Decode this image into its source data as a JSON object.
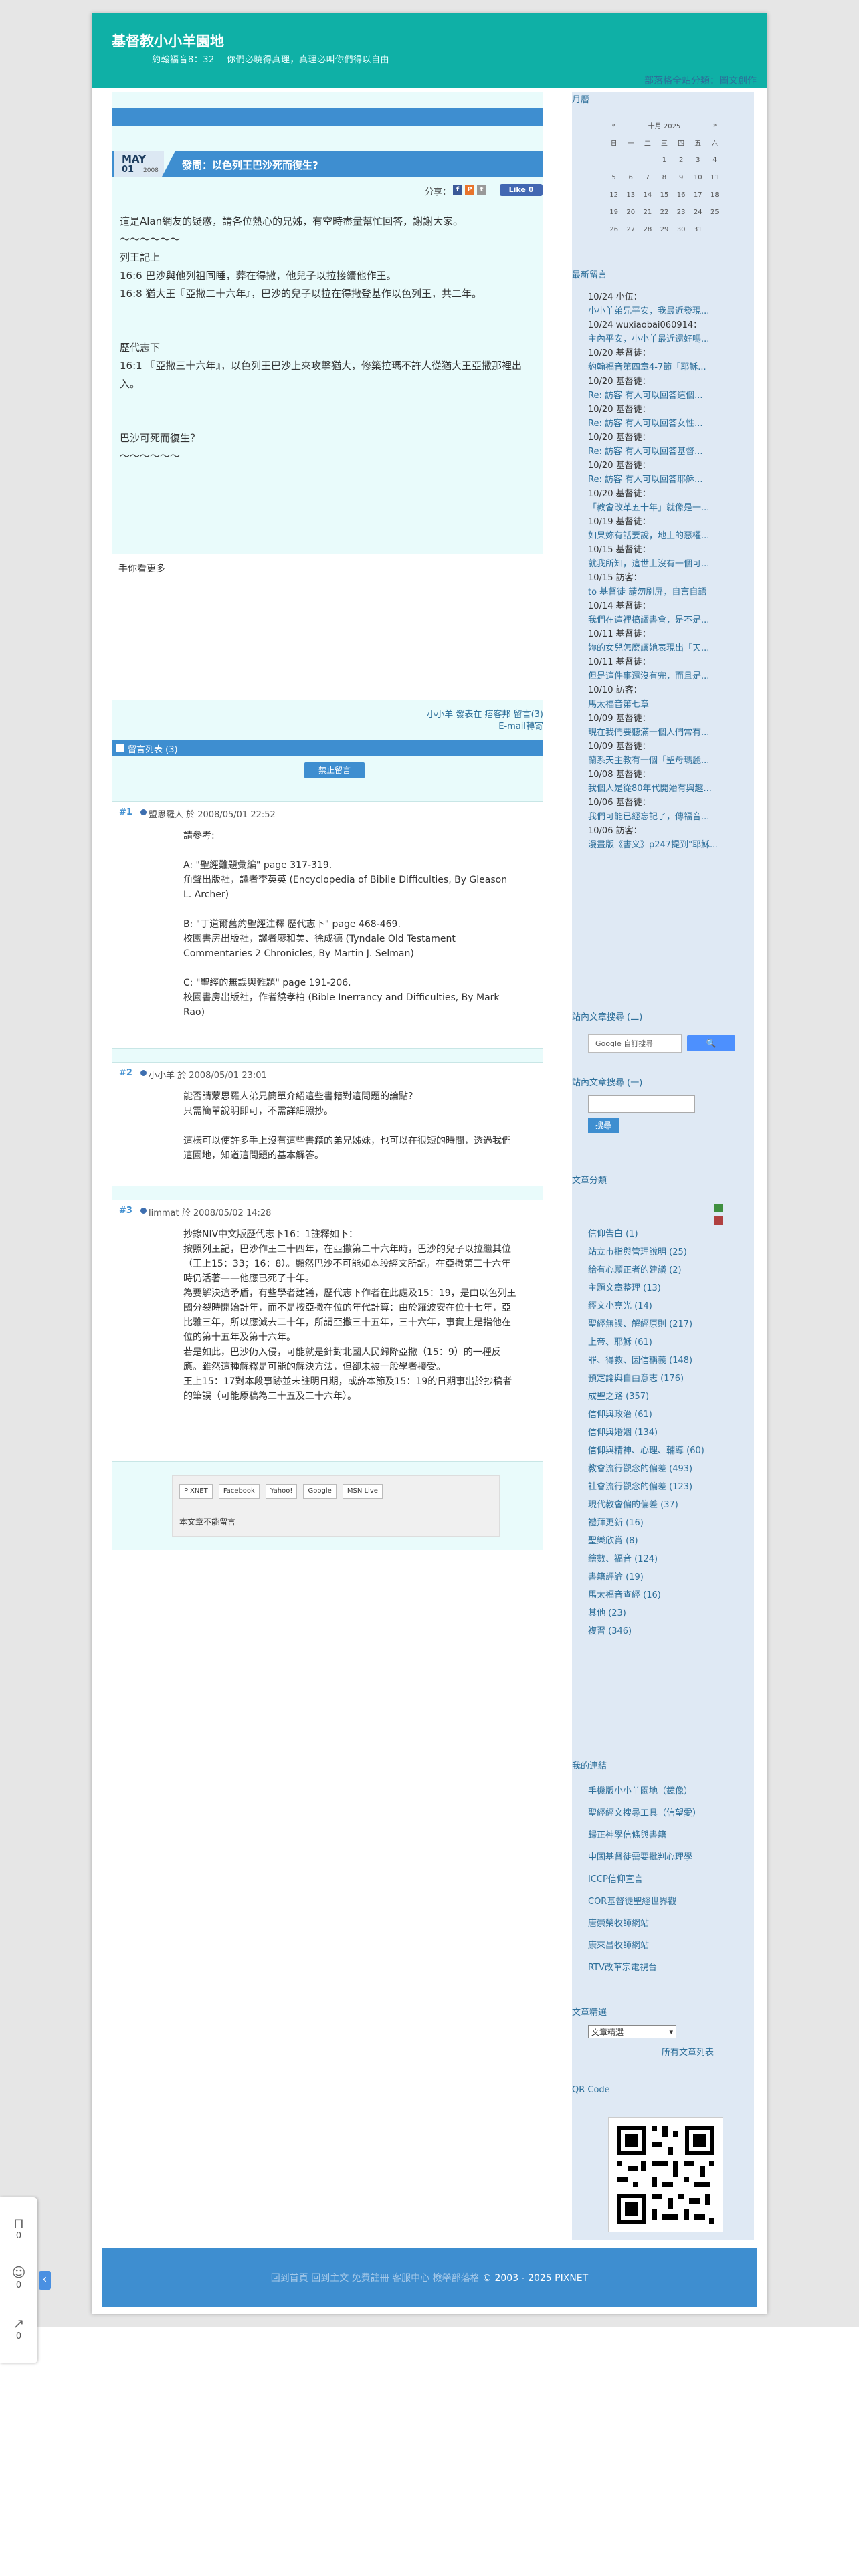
{
  "header": {
    "title": "基督教小小羊園地",
    "description": "約翰福音8：32　 你們必曉得真理，真理必叫你們得以自由",
    "category_link": "部落格全站分類：圖文創作"
  },
  "post": {
    "date": {
      "month": "MAY",
      "day": "01",
      "year": "2008"
    },
    "title": "發問：以色列王巴沙死而復生?",
    "share_label": "分享：",
    "like_label": "Like 0",
    "body": [
      "這是Alan網友的疑惑，請各位熱心的兄姊，有空時盡量幫忙回答，謝謝大家。",
      "〜〜〜〜〜〜",
      "列王記上",
      "16:6 巴沙與他列祖同睡，葬在得撒，他兒子以拉接續他作王。",
      "16:8 猶大王『亞撒二十六年』，巴沙的兒子以拉在得撒登基作以色列王，共二年。",
      "",
      "",
      "歷代志下",
      "16:1 『亞撒三十六年』，以色列王巴沙上來攻擊猶大，修築拉瑪不許人從猶大王亞撒那裡出入。",
      "",
      "",
      "巴沙可死而復生？",
      "〜〜〜〜〜〜"
    ],
    "recommend_label": "手你看更多",
    "meta_line1": "小小羊 發表在 痞客邦 留言(3)",
    "meta_line2": "E-mail轉寄"
  },
  "comments_header": "留言列表 (3)",
  "disable_comment_button": "禁止留言",
  "comments": [
    {
      "num": "#1",
      "author_line": "盟思羅人 於 2008/05/01 22:52",
      "body": "請參考:\n\nA: \"聖經難題彙編\" page 317-319.\n角聲出版社，譯者李英英 (Encyclopedia of Bibile Difficulties, By Gleason L. Archer)\n\nB: \"丁道爾舊約聖經注釋 歷代志下\" page 468-469.\n校園書房出版社，譯者廖和美、徐成德 (Tyndale Old Testament Commentaries 2 Chronicles, By Martin J. Selman)\n\nC: \"聖經的無誤與難題\" page 191-206.\n校園書房出版社，作者饒孝柏 (Bible Inerrancy and Difficulties, By Mark Rao)"
    },
    {
      "num": "#2",
      "author_line": "小小羊 於 2008/05/01 23:01",
      "body": "能否請蒙思羅人弟兄簡單介紹這些書籍對這問題的論點？\n只需簡單說明即可，不需詳細照抄。\n\n這樣可以使許多手上沒有這些書籍的弟兄姊妹，也可以在很短的時間，透過我們這園地，知道這問題的基本解答。"
    },
    {
      "num": "#3",
      "author_line": "limmat 於 2008/05/02 14:28",
      "body": "抄錄NIV中文版歷代志下16：1註釋如下：\n按照列王記，巴沙作王二十四年，在亞撒第二十六年時，巴沙的兒子以拉繼其位（王上15：33；16：8）。顯然巴沙不可能如本段經文所記，在亞撒第三十六年時仍活著——他應已死了十年。\n為要解決這矛盾，有些學者建議，歷代志下作者在此處及15：19，是由以色列王國分裂時開始計年，而不是按亞撒在位的年代計算：由於羅波安在位十七年，亞比雅三年，所以應減去二十年，所謂亞撒三十五年，三十六年，事實上是指他在位的第十五年及第十六年。\n若是如此，巴沙仍入侵，可能就是針對北國人民歸降亞撒（15：9）的一種反應。雖然這種解釋是可能的解決方法，但卻未被一般學者接受。\n王上15：17對本段事跡並未註明日期，或許本節及15：19的日期事出於抄稿者的筆誤（可能原稿為二十五及二十六年）。"
    }
  ],
  "share_tool": {
    "buttons": [
      "PIXNET",
      "Facebook",
      "Yahoo!",
      "Google",
      "MSN Live"
    ],
    "note": "本文章不能留言"
  },
  "sidebar": {
    "calendar_title": "月曆",
    "calendar_month": "十月 2025",
    "calendar_prev": "«",
    "calendar_next": "»",
    "weekdays": [
      "日",
      "一",
      "二",
      "三",
      "四",
      "五",
      "六"
    ],
    "weeks": [
      [
        "",
        "",
        "",
        "1",
        "2",
        "3",
        "4"
      ],
      [
        "5",
        "6",
        "7",
        "8",
        "9",
        "10",
        "11"
      ],
      [
        "12",
        "13",
        "14",
        "15",
        "16",
        "17",
        "18"
      ],
      [
        "19",
        "20",
        "21",
        "22",
        "23",
        "24",
        "25"
      ],
      [
        "26",
        "27",
        "28",
        "29",
        "30",
        "31",
        ""
      ]
    ],
    "latest_comments_title": "最新留言",
    "latest_comments": [
      "10/24 小伍：",
      "小小羊弟兄平安，我最近發現...",
      "10/24 wuxiaobai060914：",
      "主內平安，小小羊最近還好嗎...",
      "10/20 基督徒：",
      "約翰福音第四章4-7節「耶穌...",
      "10/20 基督徒：",
      "Re: 訪客 有人可以回答這個...",
      "10/20 基督徒：",
      "Re: 訪客 有人可以回答女性...",
      "10/20 基督徒：",
      "Re: 訪客 有人可以回答基督...",
      "10/20 基督徒：",
      "Re: 訪客 有人可以回答耶穌...",
      "10/20 基督徒：",
      "「教會改革五十年」就像是一...",
      "10/19 基督徒：",
      "如果妳有話要說，地上的惡權...",
      "10/15 基督徒：",
      "就我所知，這世上沒有一個可...",
      "10/15 訪客：",
      "to 基督徒 請勿刷屏，自言自語",
      "10/14 基督徒：",
      "我們在這裡搞讀書會，是不是...",
      "10/11 基督徒：",
      "妳的女兒怎麼讓她表現出「天...",
      "10/11 基督徒：",
      "但是這件事還沒有完，而且是...",
      "10/10 訪客：",
      "馬太福音第七章",
      "10/09 基督徒：",
      "現在我們要聽滿一個人們常有...",
      "10/09 基督徒：",
      "蘭系天主教有一個「聖母瑪麗...",
      "10/08 基督徒：",
      "我個人是從80年代開始有與趣...",
      "10/06 基督徒：",
      "我們可能已經忘記了，傳福音...",
      "10/06 訪客：",
      "漫畫版《書义》p247提到\"耶穌..."
    ],
    "google_search_title": "站內文章搜尋 (二)",
    "google_placeholder": "Google 自訂搜尋",
    "blog_search_title": "站內文章搜尋 (一)",
    "blog_search_button": "搜尋",
    "categories_title": "文章分類",
    "categories": [
      "信仰告白 (1)",
      "站立市指與管理說明 (25)",
      "給有心願正者的建議 (2)",
      "主題文章整理 (13)",
      "經文小亮光 (14)",
      "聖經無誤、解經原則 (217)",
      "上帝、耶穌 (61)",
      "罪、得救、因信稱義 (148)",
      "預定論與自由意志 (176)",
      "成聖之路 (357)",
      "信仰與政治 (61)",
      "信仰與婚姻 (134)",
      "信仰與精神、心理、輔導 (60)",
      "教會流行觀念的偏差 (493)",
      "社會流行觀念的偏差 (123)",
      "現代教會偏的偏差 (37)",
      "禮拜更新 (16)",
      "聖樂欣賞 (8)",
      "繪數、福音 (124)",
      "書籍評論 (19)",
      "馬太福音查經 (16)",
      "其他 (23)",
      "複習 (346)"
    ],
    "links_title": "我的連結",
    "links": [
      "手機版小小羊園地（鏡像）",
      "聖經經文搜尋工具（信望愛）",
      "歸正神學信條與書籍",
      "中國基督徒需要批判心理學",
      "ICCP信仰宣言",
      "COR基督徒聖經世界觀",
      "唐崇榮牧師網站",
      "康來昌牧師網站",
      "RTV改革宗電視台"
    ],
    "archive_title": "文章精選",
    "archive_select": "文章精選",
    "archive_all": "所有文章列表",
    "qr_title": "QR Code"
  },
  "footer": {
    "menu": "回到首頁 回到主文 免費註冊 客服中心 檢舉部落格",
    "copyright": "© 2003 - 2025 PIXNET"
  },
  "floatbar": {
    "count1": "0",
    "count2": "0",
    "count3": "0"
  }
}
